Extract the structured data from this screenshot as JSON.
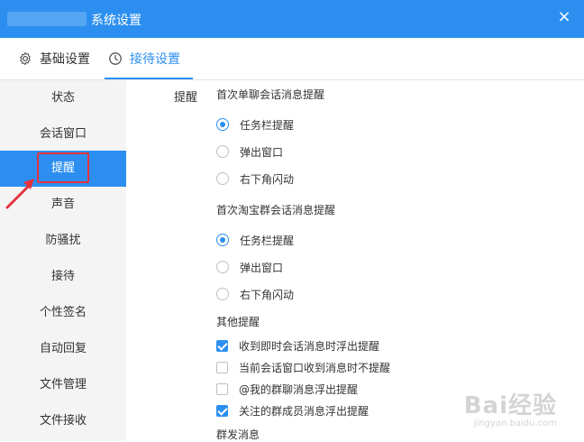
{
  "window": {
    "title": "系统设置",
    "close": "×"
  },
  "tabs": [
    {
      "label": "基础设置",
      "icon": "gear-icon"
    },
    {
      "label": "接待设置",
      "icon": "clock-icon",
      "active": true
    }
  ],
  "sidebar": {
    "items": [
      {
        "label": "状态"
      },
      {
        "label": "会话窗口"
      },
      {
        "label": "提醒",
        "active": true
      },
      {
        "label": "声音"
      },
      {
        "label": "防骚扰"
      },
      {
        "label": "接待"
      },
      {
        "label": "个性签名"
      },
      {
        "label": "自动回复"
      },
      {
        "label": "文件管理"
      },
      {
        "label": "文件接收"
      }
    ]
  },
  "content": {
    "section_label": "提醒",
    "groups": [
      {
        "title": "首次单聊会话消息提醒",
        "options": [
          {
            "label": "任务栏提醒",
            "selected": true
          },
          {
            "label": "弹出窗口",
            "selected": false
          },
          {
            "label": "右下角闪动",
            "selected": false
          }
        ]
      },
      {
        "title": "首次淘宝群会话消息提醒",
        "options": [
          {
            "label": "任务栏提醒",
            "selected": true
          },
          {
            "label": "弹出窗口",
            "selected": false
          },
          {
            "label": "右下角闪动",
            "selected": false
          }
        ]
      },
      {
        "title": "其他提醒",
        "checkboxes": [
          {
            "label": "收到即时会话消息时浮出提醒",
            "checked": true
          },
          {
            "label": "当前会话窗口收到消息时不提醒",
            "checked": false
          },
          {
            "label": "@我的群聊消息浮出提醒",
            "checked": false
          },
          {
            "label": "关注的群成员消息浮出提醒",
            "checked": true
          }
        ]
      },
      {
        "title": "群发消息"
      }
    ]
  },
  "watermark": {
    "main": "Bai经验",
    "sub": "jingyan.baidu.com"
  },
  "colors": {
    "accent": "#2c8ff0",
    "highlight": "#e5333d",
    "sidebar_bg": "#f4f4f4"
  }
}
